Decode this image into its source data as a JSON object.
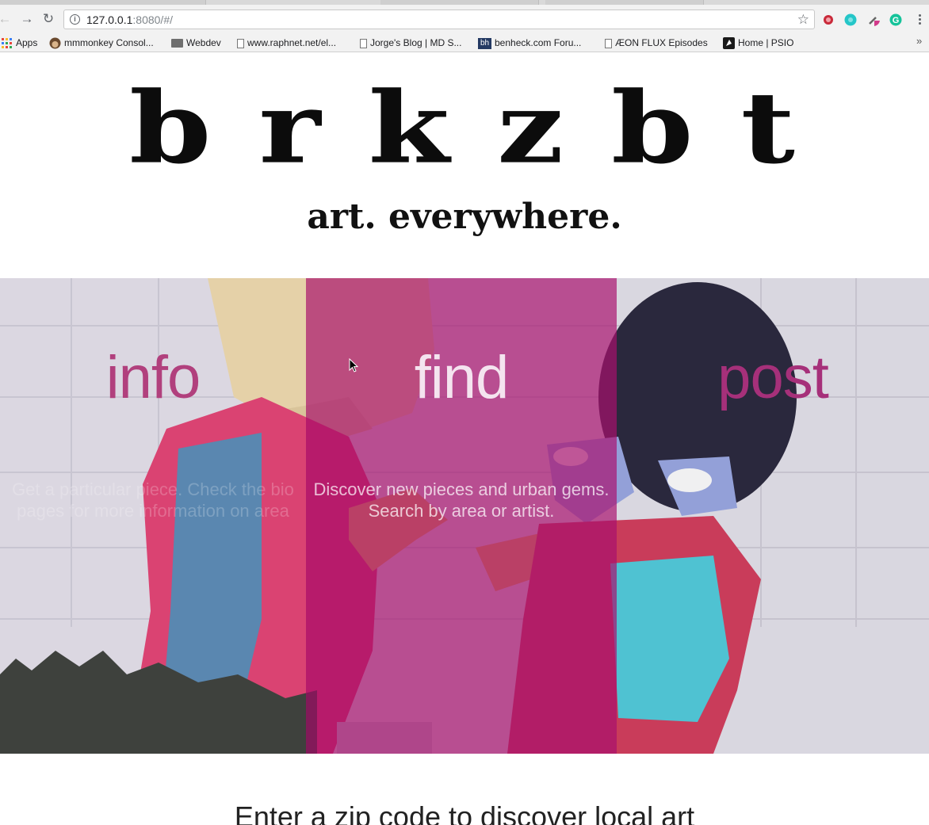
{
  "browser": {
    "url_host": "127.0.0.1",
    "url_rest": ":8080/#/",
    "bookmarks": [
      {
        "label": "Apps",
        "icon": "apps-grid-icon"
      },
      {
        "label": "mmmonkey Consol...",
        "icon": "monkey-favicon"
      },
      {
        "label": "Webdev",
        "icon": "folder-icon"
      },
      {
        "label": "www.raphnet.net/el...",
        "icon": "page-icon"
      },
      {
        "label": "Jorge's Blog | MD S...",
        "icon": "page-icon"
      },
      {
        "label": "benheck.com Foru...",
        "icon": "bh-favicon"
      },
      {
        "label": "ÆON FLUX Episodes",
        "icon": "page-icon"
      },
      {
        "label": "Home | PSIO",
        "icon": "psio-favicon"
      }
    ],
    "bh_badge": "bh"
  },
  "site": {
    "logo": [
      "b",
      "r",
      "k",
      "z",
      "b",
      "t"
    ],
    "tagline": "art. everywhere."
  },
  "panels": [
    {
      "title": "info",
      "description": "Get a particular piece. Check the bio pages for more information on area"
    },
    {
      "title": "find",
      "description": "Discover new pieces and urban gems. Search by area or artist."
    },
    {
      "title": "post",
      "description": ""
    }
  ],
  "zip_heading": "Enter a zip code to discover local art",
  "colors": {
    "accent": "#aa1973",
    "panel_title_pink": "#b1407d",
    "logo_black": "#0c0c0c"
  }
}
